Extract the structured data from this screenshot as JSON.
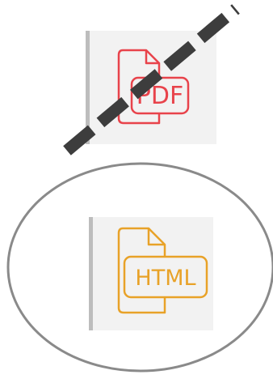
{
  "items": [
    {
      "id": "pdf",
      "label": "PDF",
      "icon": "pdf-file-icon",
      "color": "#e8434b",
      "status": "rejected",
      "marker": "dashed-strike-through"
    },
    {
      "id": "html",
      "label": "HTML",
      "icon": "html-file-icon",
      "color": "#e8a228",
      "status": "selected",
      "marker": "circle"
    }
  ],
  "colors": {
    "tile_background": "#f2f2f2",
    "tile_edge": "#bdbdbd",
    "strike": "#3d3d3d",
    "circle": "#8a8a8a"
  }
}
